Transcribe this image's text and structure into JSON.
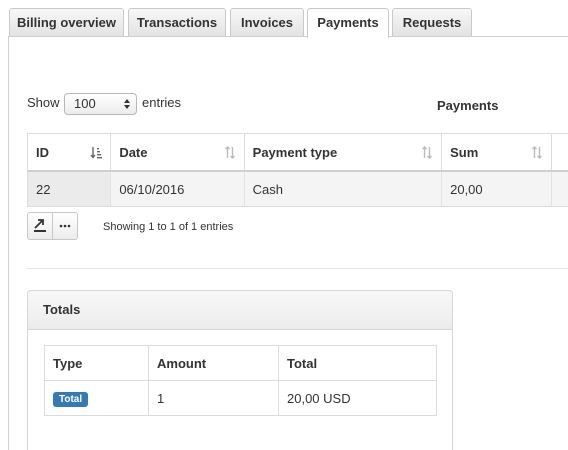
{
  "tabs": [
    {
      "label": "Billing overview",
      "active": false
    },
    {
      "label": "Transactions",
      "active": false
    },
    {
      "label": "Invoices",
      "active": false
    },
    {
      "label": "Payments",
      "active": true
    },
    {
      "label": "Requests",
      "active": false
    }
  ],
  "length_menu": {
    "prefix": "Show",
    "value": "100",
    "suffix": "entries"
  },
  "table_title": "Payments",
  "payments_table": {
    "columns": [
      "ID",
      "Date",
      "Payment type",
      "Sum"
    ],
    "rows": [
      [
        "22",
        "06/10/2016",
        "Cash",
        "20,00"
      ]
    ]
  },
  "info_text": "Showing 1 to 1 of 1 entries",
  "totals": {
    "title": "Totals",
    "columns": [
      "Type",
      "Amount",
      "Total"
    ],
    "rows": [
      {
        "type_badge": "Total",
        "amount": "1",
        "total": "20,00 USD"
      }
    ]
  },
  "colors": {
    "badge": "#337ab7"
  }
}
